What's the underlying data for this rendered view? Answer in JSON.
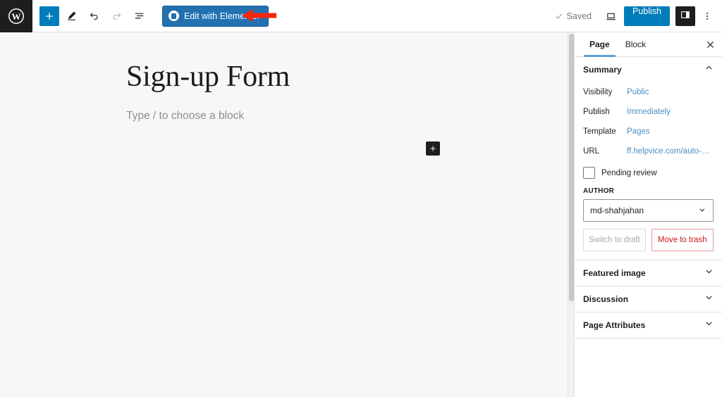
{
  "toolbar": {
    "wp_logo_label": "WordPress",
    "add_block_label": "Toggle block inserter",
    "tools_label": "Tools",
    "undo_label": "Undo",
    "redo_label": "Redo",
    "outline_label": "Document Overview",
    "elementor_button_label": "Edit with Elementor",
    "saved_label": "Saved",
    "preview_label": "View",
    "publish_label": "Publish",
    "settings_toggle_label": "Settings",
    "more_label": "Options"
  },
  "annotation": {
    "arrow_color": "#f4250b",
    "arrow_direction": "left",
    "points_at": "Edit with Elementor"
  },
  "canvas": {
    "post_title": "Sign-up Form",
    "block_placeholder": "Type / to choose a block",
    "inserter_label": "Add block"
  },
  "sidebar": {
    "tabs": [
      {
        "label": "Page",
        "active": true
      },
      {
        "label": "Block",
        "active": false
      }
    ],
    "close_label": "Close settings",
    "summary": {
      "title": "Summary",
      "expanded": true,
      "rows": [
        {
          "label": "Visibility",
          "value": "Public"
        },
        {
          "label": "Publish",
          "value": "Immediately"
        },
        {
          "label": "Template",
          "value": "Pages"
        },
        {
          "label": "URL",
          "value": "ff.helpvice.com/auto-…"
        }
      ],
      "pending_review": {
        "label": "Pending review",
        "checked": false
      },
      "author": {
        "label": "AUTHOR",
        "value": "md-shahjahan"
      },
      "switch_to_draft_label": "Switch to draft",
      "move_to_trash_label": "Move to trash"
    },
    "panels": [
      {
        "title": "Featured image",
        "expanded": false
      },
      {
        "title": "Discussion",
        "expanded": false
      },
      {
        "title": "Page Attributes",
        "expanded": false
      }
    ]
  },
  "colors": {
    "accent_blue": "#007cba",
    "elementor_blue": "#2271b1",
    "link_blue": "#4a8fc4",
    "danger_red": "#cc1818",
    "dark": "#1e1e1e",
    "canvas_bg": "#f7f7f7"
  }
}
